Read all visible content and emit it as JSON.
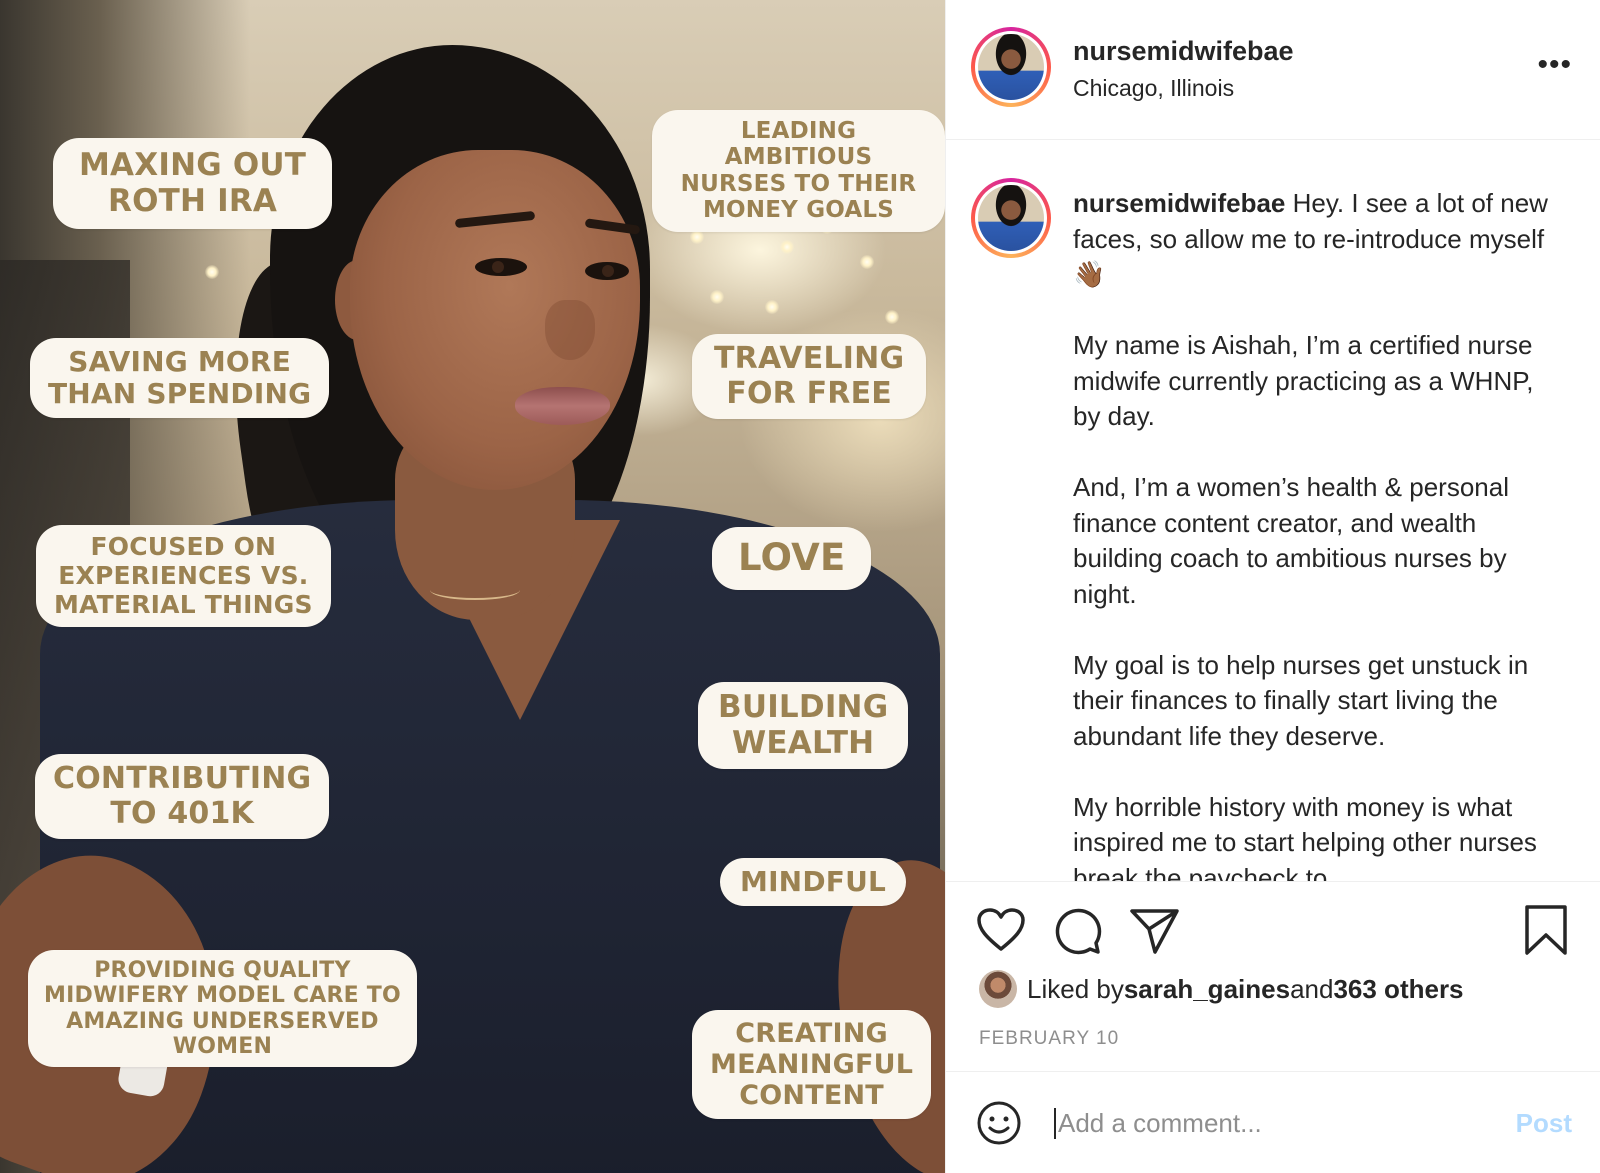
{
  "photo": {
    "stickers": [
      {
        "id": "maxing",
        "text": "MAXING OUT\nROTH IRA"
      },
      {
        "id": "leading",
        "text": "LEADING AMBITIOUS\nNURSES TO THEIR\nMONEY GOALS"
      },
      {
        "id": "saving",
        "text": "SAVING MORE\nTHAN SPENDING"
      },
      {
        "id": "traveling",
        "text": "TRAVELING\nFOR FREE"
      },
      {
        "id": "focused",
        "text": "FOCUSED ON\nEXPERIENCES VS.\nMATERIAL THINGS"
      },
      {
        "id": "love",
        "text": "LOVE"
      },
      {
        "id": "building",
        "text": "BUILDING\nWEALTH"
      },
      {
        "id": "contributing",
        "text": "CONTRIBUTING\nTO 401K"
      },
      {
        "id": "mindful",
        "text": "MINDFUL"
      },
      {
        "id": "providing",
        "text": "PROVIDING QUALITY\nMIDWIFERY MODEL CARE TO\nAMAZING UNDERSERVED\nWOMEN"
      },
      {
        "id": "creating",
        "text": "CREATING\nMEANINGFUL\nCONTENT"
      }
    ]
  },
  "header": {
    "username": "nursemidwifebae",
    "location": "Chicago, Illinois",
    "more_icon": "more-horizontal-icon"
  },
  "caption": {
    "username": "nursemidwifebae",
    "first_line": " Hey. I see a lot of new faces, so allow me to re-introduce myself 👋🏾",
    "paragraphs": [
      "My name is Aishah, I’m a certified nurse midwife currently practicing as a WHNP, by day.",
      "And, I’m a women’s health & personal finance content creator, and wealth building coach to ambitious nurses by night.",
      "My goal is to help nurses get unstuck in their finances to finally start living the abundant life they deserve.",
      "My horrible history with money is what inspired me to start helping other nurses break the paycheck to"
    ]
  },
  "actions": {
    "icons": [
      "heart-icon",
      "comment-icon",
      "share-icon",
      "bookmark-icon"
    ],
    "liked_by_prefix": "Liked by ",
    "liked_by_user": "sarah_gaines",
    "liked_by_mid": " and ",
    "liked_by_others": "363 others",
    "date": "FEBRUARY 10"
  },
  "comment": {
    "placeholder": "Add a comment...",
    "post_label": "Post"
  },
  "colors": {
    "sticker_bg": "#faf6ee",
    "sticker_text": "#9b8252",
    "post_disabled": "#b3dbff",
    "muted": "#8e8e8e"
  }
}
